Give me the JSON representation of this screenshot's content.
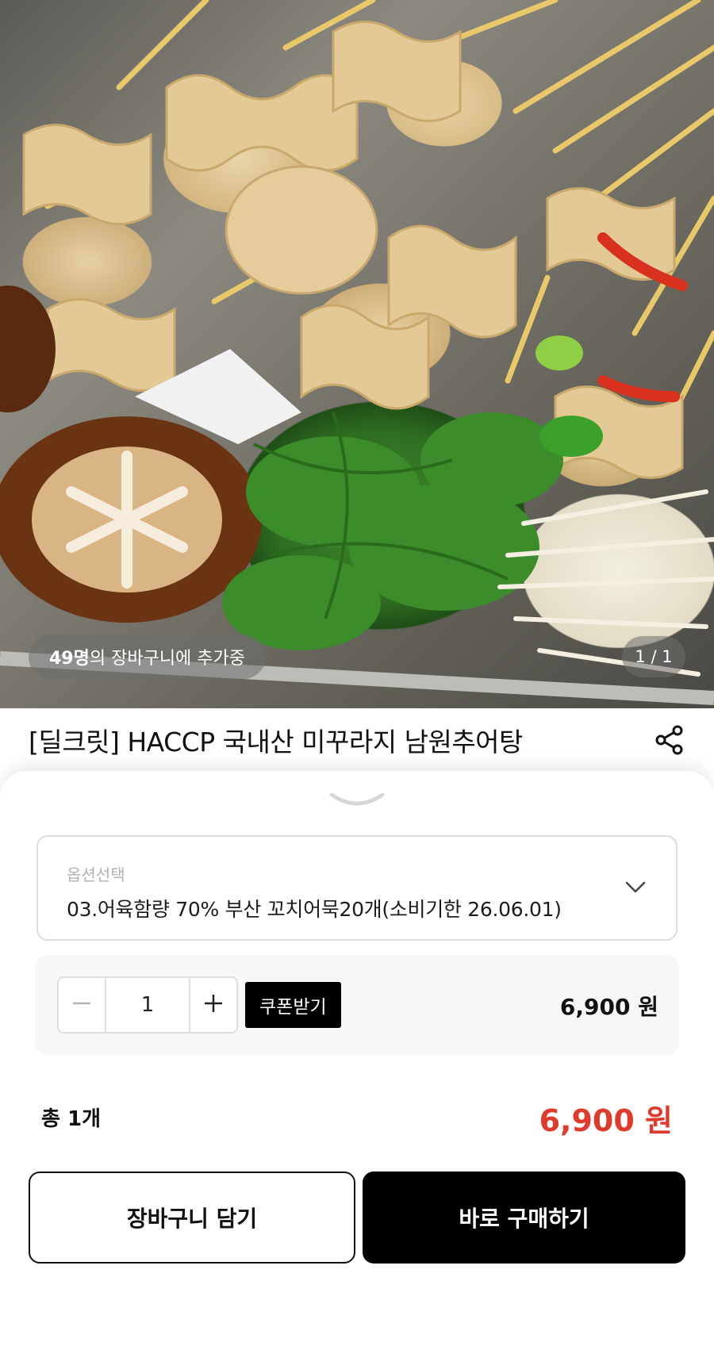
{
  "hero": {
    "cart_count_number": "49명",
    "cart_count_text": "의 장바구니에 추가중",
    "page_indicator": "1 / 1"
  },
  "product": {
    "title": "[딜크릿] HACCP 국내산 미꾸라지 남원추어탕"
  },
  "options": {
    "label": "옵션선택",
    "selected": "03.어육함량 70% 부산 꼬치어묵20개(소비기한 26.06.01)"
  },
  "quantity": {
    "value": "1",
    "coupon_label": "쿠폰받기",
    "line_price": "6,900 원"
  },
  "total": {
    "count_label": "총 1개",
    "price": "6,900 원"
  },
  "actions": {
    "add_to_cart": "장바구니 담기",
    "buy_now": "바로 구매하기"
  },
  "colors": {
    "accent_price": "#e03a2c",
    "primary_button": "#000000"
  },
  "icons": [
    "share-icon",
    "sheet-collapse-icon",
    "chevron-down-icon",
    "minus-icon",
    "plus-icon"
  ]
}
